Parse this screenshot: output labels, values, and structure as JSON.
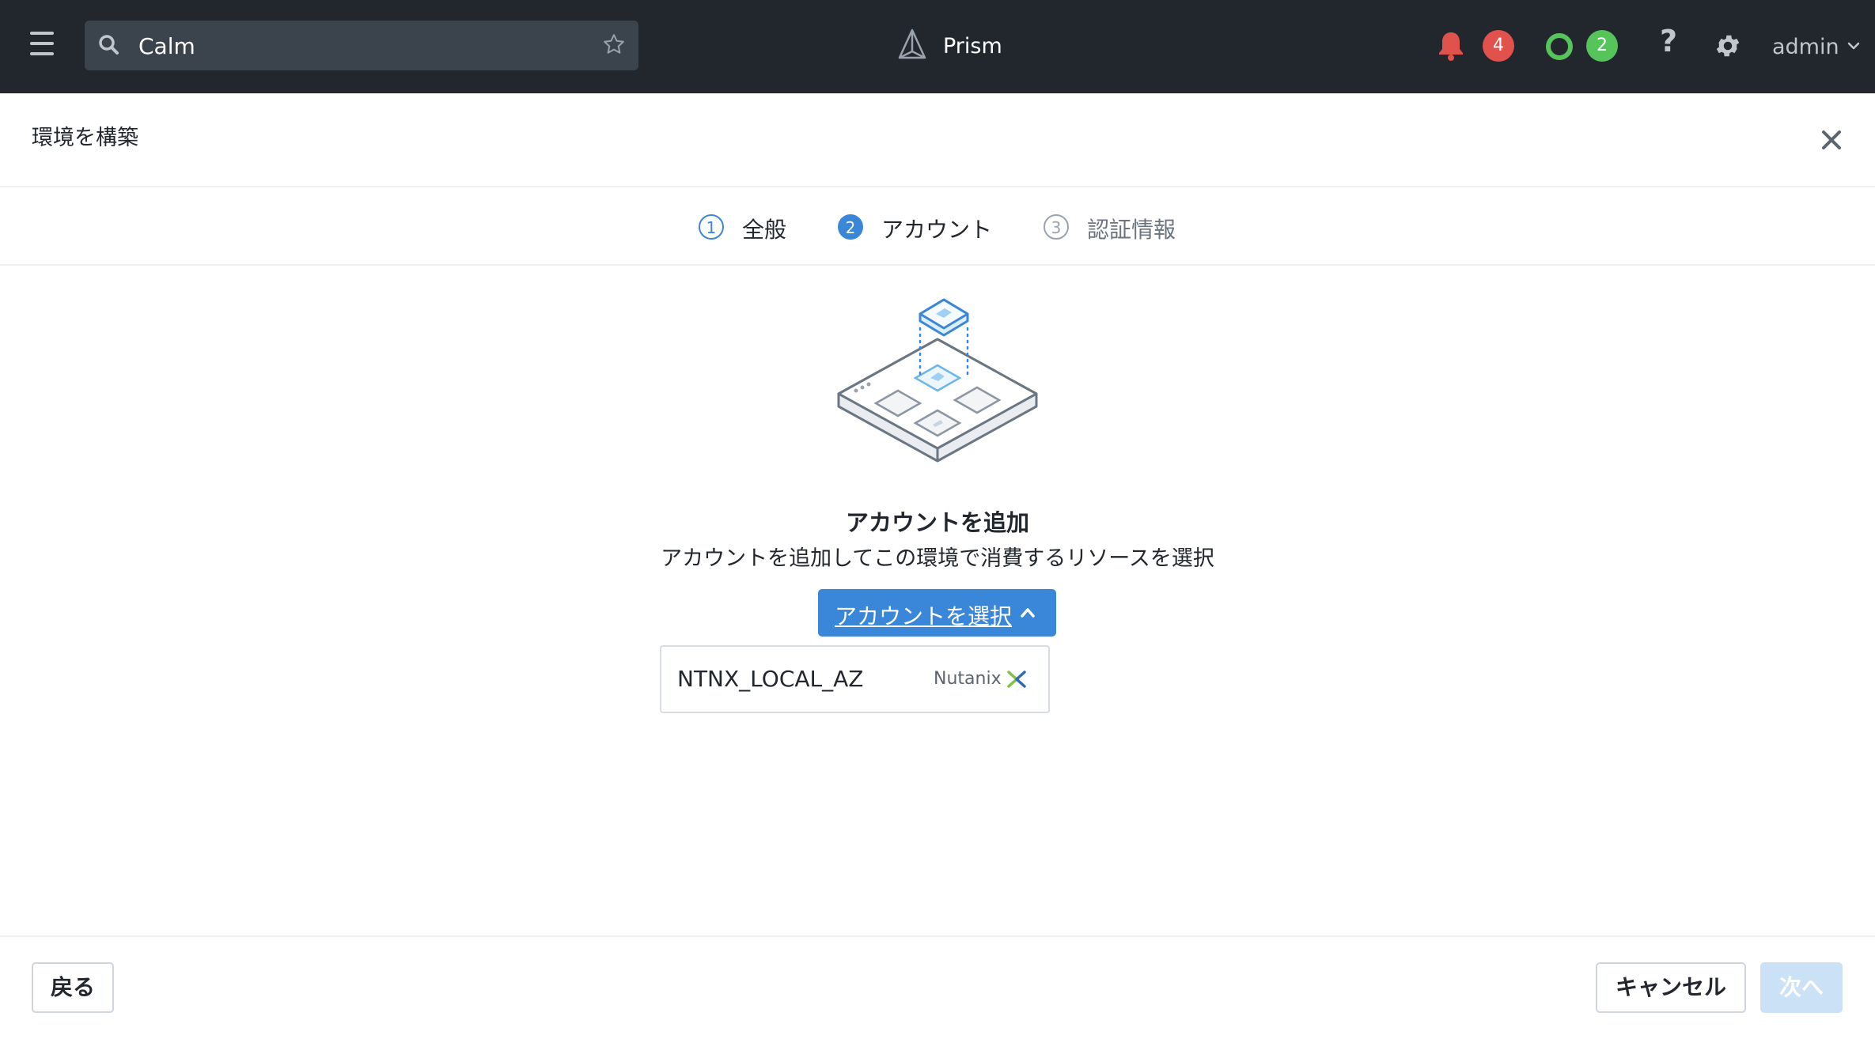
{
  "topbar": {
    "search_value": "Calm",
    "app_name": "Prism",
    "alerts_count": "4",
    "tasks_count": "2",
    "help_label": "?",
    "user_name": "admin"
  },
  "dialog": {
    "title": "環境を構築",
    "steps": [
      {
        "number": "1",
        "label": "全般",
        "state": "completed"
      },
      {
        "number": "2",
        "label": "アカウント",
        "state": "active"
      },
      {
        "number": "3",
        "label": "認証情報",
        "state": "pending"
      }
    ],
    "content": {
      "heading": "アカウントを追加",
      "description": "アカウントを追加してこの環境で消費するリソースを選択",
      "select_button": "アカウントを選択",
      "accounts": [
        {
          "name": "NTNX_LOCAL_AZ",
          "provider": "Nutanix"
        }
      ]
    },
    "footer": {
      "back": "戻る",
      "cancel": "キャンセル",
      "next": "次へ"
    }
  },
  "colors": {
    "topbar_bg": "#22272e",
    "accent": "#3a86d8",
    "alert_red": "#e0524b",
    "success_green": "#56c35b",
    "next_disabled": "#cbe2f6"
  },
  "icons": [
    "hamburger-icon",
    "search-icon",
    "star-icon",
    "prism-logo-icon",
    "bell-icon",
    "status-ring-icon",
    "help-icon",
    "gear-icon",
    "chevron-down-icon",
    "close-icon",
    "chevron-up-icon",
    "nutanix-logo-icon"
  ]
}
